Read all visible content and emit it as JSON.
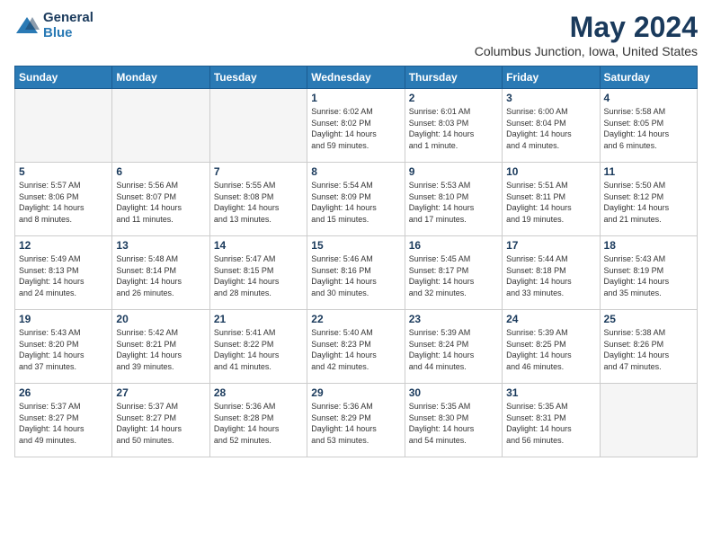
{
  "logo": {
    "general": "General",
    "blue": "Blue"
  },
  "title": "May 2024",
  "location": "Columbus Junction, Iowa, United States",
  "days_of_week": [
    "Sunday",
    "Monday",
    "Tuesday",
    "Wednesday",
    "Thursday",
    "Friday",
    "Saturday"
  ],
  "weeks": [
    [
      {
        "day": "",
        "info": ""
      },
      {
        "day": "",
        "info": ""
      },
      {
        "day": "",
        "info": ""
      },
      {
        "day": "1",
        "info": "Sunrise: 6:02 AM\nSunset: 8:02 PM\nDaylight: 14 hours\nand 59 minutes."
      },
      {
        "day": "2",
        "info": "Sunrise: 6:01 AM\nSunset: 8:03 PM\nDaylight: 14 hours\nand 1 minute."
      },
      {
        "day": "3",
        "info": "Sunrise: 6:00 AM\nSunset: 8:04 PM\nDaylight: 14 hours\nand 4 minutes."
      },
      {
        "day": "4",
        "info": "Sunrise: 5:58 AM\nSunset: 8:05 PM\nDaylight: 14 hours\nand 6 minutes."
      }
    ],
    [
      {
        "day": "5",
        "info": "Sunrise: 5:57 AM\nSunset: 8:06 PM\nDaylight: 14 hours\nand 8 minutes."
      },
      {
        "day": "6",
        "info": "Sunrise: 5:56 AM\nSunset: 8:07 PM\nDaylight: 14 hours\nand 11 minutes."
      },
      {
        "day": "7",
        "info": "Sunrise: 5:55 AM\nSunset: 8:08 PM\nDaylight: 14 hours\nand 13 minutes."
      },
      {
        "day": "8",
        "info": "Sunrise: 5:54 AM\nSunset: 8:09 PM\nDaylight: 14 hours\nand 15 minutes."
      },
      {
        "day": "9",
        "info": "Sunrise: 5:53 AM\nSunset: 8:10 PM\nDaylight: 14 hours\nand 17 minutes."
      },
      {
        "day": "10",
        "info": "Sunrise: 5:51 AM\nSunset: 8:11 PM\nDaylight: 14 hours\nand 19 minutes."
      },
      {
        "day": "11",
        "info": "Sunrise: 5:50 AM\nSunset: 8:12 PM\nDaylight: 14 hours\nand 21 minutes."
      }
    ],
    [
      {
        "day": "12",
        "info": "Sunrise: 5:49 AM\nSunset: 8:13 PM\nDaylight: 14 hours\nand 24 minutes."
      },
      {
        "day": "13",
        "info": "Sunrise: 5:48 AM\nSunset: 8:14 PM\nDaylight: 14 hours\nand 26 minutes."
      },
      {
        "day": "14",
        "info": "Sunrise: 5:47 AM\nSunset: 8:15 PM\nDaylight: 14 hours\nand 28 minutes."
      },
      {
        "day": "15",
        "info": "Sunrise: 5:46 AM\nSunset: 8:16 PM\nDaylight: 14 hours\nand 30 minutes."
      },
      {
        "day": "16",
        "info": "Sunrise: 5:45 AM\nSunset: 8:17 PM\nDaylight: 14 hours\nand 32 minutes."
      },
      {
        "day": "17",
        "info": "Sunrise: 5:44 AM\nSunset: 8:18 PM\nDaylight: 14 hours\nand 33 minutes."
      },
      {
        "day": "18",
        "info": "Sunrise: 5:43 AM\nSunset: 8:19 PM\nDaylight: 14 hours\nand 35 minutes."
      }
    ],
    [
      {
        "day": "19",
        "info": "Sunrise: 5:43 AM\nSunset: 8:20 PM\nDaylight: 14 hours\nand 37 minutes."
      },
      {
        "day": "20",
        "info": "Sunrise: 5:42 AM\nSunset: 8:21 PM\nDaylight: 14 hours\nand 39 minutes."
      },
      {
        "day": "21",
        "info": "Sunrise: 5:41 AM\nSunset: 8:22 PM\nDaylight: 14 hours\nand 41 minutes."
      },
      {
        "day": "22",
        "info": "Sunrise: 5:40 AM\nSunset: 8:23 PM\nDaylight: 14 hours\nand 42 minutes."
      },
      {
        "day": "23",
        "info": "Sunrise: 5:39 AM\nSunset: 8:24 PM\nDaylight: 14 hours\nand 44 minutes."
      },
      {
        "day": "24",
        "info": "Sunrise: 5:39 AM\nSunset: 8:25 PM\nDaylight: 14 hours\nand 46 minutes."
      },
      {
        "day": "25",
        "info": "Sunrise: 5:38 AM\nSunset: 8:26 PM\nDaylight: 14 hours\nand 47 minutes."
      }
    ],
    [
      {
        "day": "26",
        "info": "Sunrise: 5:37 AM\nSunset: 8:27 PM\nDaylight: 14 hours\nand 49 minutes."
      },
      {
        "day": "27",
        "info": "Sunrise: 5:37 AM\nSunset: 8:27 PM\nDaylight: 14 hours\nand 50 minutes."
      },
      {
        "day": "28",
        "info": "Sunrise: 5:36 AM\nSunset: 8:28 PM\nDaylight: 14 hours\nand 52 minutes."
      },
      {
        "day": "29",
        "info": "Sunrise: 5:36 AM\nSunset: 8:29 PM\nDaylight: 14 hours\nand 53 minutes."
      },
      {
        "day": "30",
        "info": "Sunrise: 5:35 AM\nSunset: 8:30 PM\nDaylight: 14 hours\nand 54 minutes."
      },
      {
        "day": "31",
        "info": "Sunrise: 5:35 AM\nSunset: 8:31 PM\nDaylight: 14 hours\nand 56 minutes."
      },
      {
        "day": "",
        "info": ""
      }
    ]
  ]
}
